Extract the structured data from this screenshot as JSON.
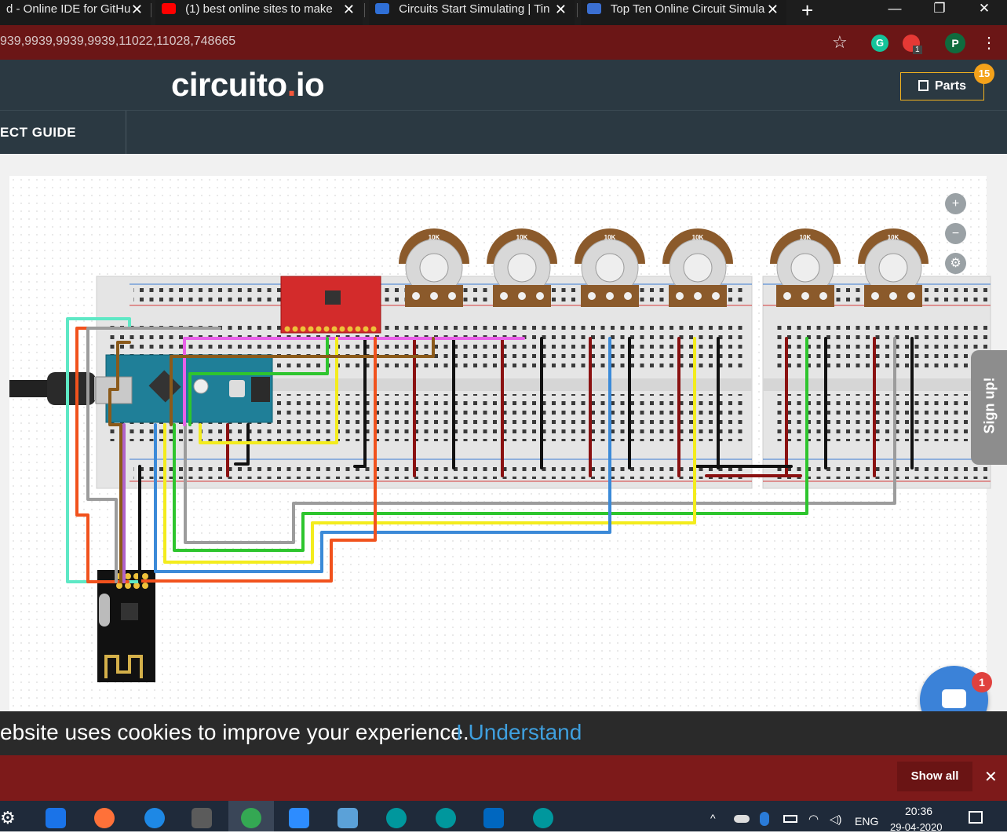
{
  "browser": {
    "tabs": [
      {
        "title": "d - Online IDE for GitHu",
        "icon": "code-icon",
        "icon_color": "#1a1a1a"
      },
      {
        "title": "(1) best online sites to make",
        "icon": "youtube-icon",
        "icon_color": "#ff0000"
      },
      {
        "title": "Circuits Start Simulating | Tin",
        "icon": "tinkercad-icon",
        "icon_color": "#2f6fd6"
      },
      {
        "title": "Top Ten Online Circuit Simula",
        "icon": "circuit-icon",
        "icon_color": "#3b6fd1"
      }
    ],
    "tab_close": "✕",
    "new_tab": "+",
    "window_controls": {
      "minimize": "—",
      "restore": "❐",
      "close": "✕"
    },
    "url": "939,9939,9939,9939,11022,11028,748665",
    "star": "☆",
    "extension_badge": "1",
    "grammarly_letter": "G",
    "profile_letter": "P",
    "menu": "⋮"
  },
  "app": {
    "logo_main": "circuito",
    "logo_dot": ".",
    "logo_tail": "io",
    "parts_label": "Parts",
    "parts_count": "15",
    "nav_label": "ECT GUIDE"
  },
  "canvas": {
    "pot_label": "10K",
    "zoom_in": "+",
    "zoom_out": "−",
    "settings": "⚙",
    "signup": "Sign up!",
    "chat_count": "1"
  },
  "cookie": {
    "text": "ebsite uses cookies to improve your experience.",
    "button": "I Understand"
  },
  "downloads": {
    "show_all": "Show all",
    "close": "✕"
  },
  "taskbar": {
    "lang": "ENG",
    "time": "20:36",
    "date": "29-04-2020",
    "colors": {
      "mail": "#1a73e8",
      "firefox": "#ff7139",
      "edge": "#1e88e5",
      "store": "#5b5b5b",
      "chrome": "#34a853",
      "zoom": "#2d8cff",
      "arduino": "#00979d",
      "photos": "#0067c0"
    }
  },
  "wire_colors": {
    "red": "#8a1111",
    "black": "#111111",
    "yellow": "#f3ec1d",
    "green": "#2ec52e",
    "blue": "#3b8ad8",
    "gray": "#9c9c9c",
    "orange": "#f1521d",
    "teal": "#5ee8c5",
    "brown": "#8b5a1a",
    "pink": "#e860e8",
    "violet": "#b062c8"
  }
}
